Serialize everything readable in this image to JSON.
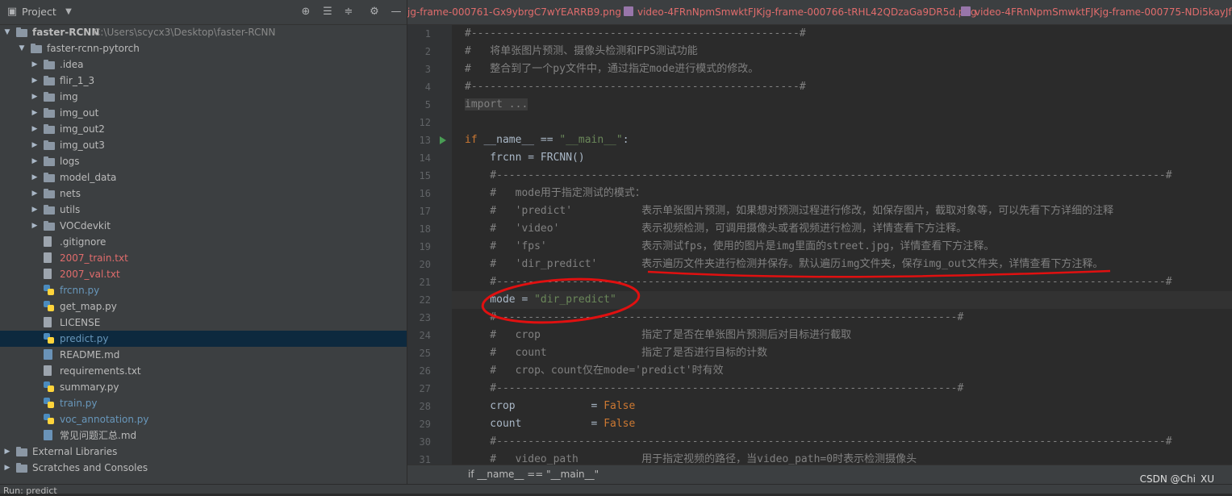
{
  "project": {
    "title": "Project",
    "tree": [
      {
        "label": "faster-RCNN",
        "extra": "C:\\Users\\scycx3\\Desktop\\faster-RCNN",
        "type": "folder",
        "depth": 0,
        "expanded": true
      },
      {
        "label": "faster-rcnn-pytorch",
        "type": "folder",
        "depth": 1,
        "expanded": true
      },
      {
        "label": ".idea",
        "type": "folder",
        "depth": 2,
        "expanded": false
      },
      {
        "label": "flir_1_3",
        "type": "folder",
        "depth": 2,
        "expanded": false
      },
      {
        "label": "img",
        "type": "folder",
        "depth": 2,
        "expanded": false
      },
      {
        "label": "img_out",
        "type": "folder",
        "depth": 2,
        "expanded": false
      },
      {
        "label": "img_out2",
        "type": "folder",
        "depth": 2,
        "expanded": false
      },
      {
        "label": "img_out3",
        "type": "folder",
        "depth": 2,
        "expanded": false
      },
      {
        "label": "logs",
        "type": "folder",
        "depth": 2,
        "expanded": false
      },
      {
        "label": "model_data",
        "type": "folder",
        "depth": 2,
        "expanded": false
      },
      {
        "label": "nets",
        "type": "folder",
        "depth": 2,
        "expanded": false
      },
      {
        "label": "utils",
        "type": "folder",
        "depth": 2,
        "expanded": false
      },
      {
        "label": "VOCdevkit",
        "type": "folder",
        "depth": 2,
        "expanded": false
      },
      {
        "label": ".gitignore",
        "type": "file",
        "depth": 2,
        "color": "gray"
      },
      {
        "label": "2007_train.txt",
        "type": "file",
        "depth": 2,
        "color": "red"
      },
      {
        "label": "2007_val.txt",
        "type": "file",
        "depth": 2,
        "color": "red"
      },
      {
        "label": "frcnn.py",
        "type": "py",
        "depth": 2,
        "color": "blue"
      },
      {
        "label": "get_map.py",
        "type": "py",
        "depth": 2,
        "color": "gray"
      },
      {
        "label": "LICENSE",
        "type": "file",
        "depth": 2,
        "color": "gray"
      },
      {
        "label": "predict.py",
        "type": "py",
        "depth": 2,
        "color": "blue",
        "selected": true
      },
      {
        "label": "README.md",
        "type": "md",
        "depth": 2,
        "color": "gray"
      },
      {
        "label": "requirements.txt",
        "type": "file",
        "depth": 2,
        "color": "gray"
      },
      {
        "label": "summary.py",
        "type": "py",
        "depth": 2,
        "color": "gray"
      },
      {
        "label": "train.py",
        "type": "py",
        "depth": 2,
        "color": "blue"
      },
      {
        "label": "voc_annotation.py",
        "type": "py",
        "depth": 2,
        "color": "blue"
      },
      {
        "label": "常见问题汇总.md",
        "type": "md",
        "depth": 2,
        "color": "gray"
      },
      {
        "label": "External Libraries",
        "type": "lib",
        "depth": 0,
        "expanded": false
      },
      {
        "label": "Scratches and Consoles",
        "type": "lib",
        "depth": 0,
        "expanded": false
      }
    ]
  },
  "tabs": [
    {
      "label": "jg-frame-000761-Gx9ybrgC7wYEARRB9.png"
    },
    {
      "label": "video-4FRnNpmSmwktFJKjg-frame-000766-tRHL42QDzaGa9DR5d.png"
    },
    {
      "label": "video-4FRnNpmSmwktFJKjg-frame-000775-NDi5kayJf6Jied5"
    }
  ],
  "editor": {
    "lines": [
      {
        "n": "1",
        "segs": [
          [
            "cmt",
            "#----------------------------------------------------#"
          ]
        ]
      },
      {
        "n": "2",
        "segs": [
          [
            "cmt",
            "#   将单张图片预测、摄像头检测和FPS测试功能"
          ]
        ]
      },
      {
        "n": "3",
        "segs": [
          [
            "cmt",
            "#   整合到了一个py文件中，通过指定mode进行模式的修改。"
          ]
        ]
      },
      {
        "n": "4",
        "segs": [
          [
            "cmt",
            "#----------------------------------------------------#"
          ]
        ]
      },
      {
        "n": "5",
        "segs": [
          [
            "fold",
            "import ..."
          ]
        ]
      },
      {
        "n": "12",
        "segs": []
      },
      {
        "n": "13",
        "segs": [
          [
            "kw",
            "if "
          ],
          [
            "",
            "__name__ == "
          ],
          [
            "str",
            "\"__main__\""
          ],
          [
            "",
            ":"
          ]
        ],
        "run": true
      },
      {
        "n": "14",
        "segs": [
          [
            "",
            "    frcnn = FRCNN()"
          ]
        ]
      },
      {
        "n": "15",
        "segs": [
          [
            "cmt",
            "    #----------------------------------------------------------------------------------------------------------#"
          ]
        ]
      },
      {
        "n": "16",
        "segs": [
          [
            "cmt",
            "    #   mode用于指定测试的模式："
          ]
        ]
      },
      {
        "n": "17",
        "segs": [
          [
            "cmt",
            "    #   'predict'           表示单张图片预测，如果想对预测过程进行修改，如保存图片，截取对象等，可以先看下方详细的注释"
          ]
        ]
      },
      {
        "n": "18",
        "segs": [
          [
            "cmt",
            "    #   'video'             表示视频检测，可调用摄像头或者视频进行检测，详情查看下方注释。"
          ]
        ]
      },
      {
        "n": "19",
        "segs": [
          [
            "cmt",
            "    #   'fps'               表示测试fps，使用的图片是img里面的street.jpg，详情查看下方注释。"
          ]
        ]
      },
      {
        "n": "20",
        "segs": [
          [
            "cmt",
            "    #   'dir_predict'       表示遍历文件夹进行检测并保存。默认遍历img文件夹，保存img_out文件夹，详情查看下方注释。"
          ]
        ]
      },
      {
        "n": "21",
        "segs": [
          [
            "cmt",
            "    #----------------------------------------------------------------------------------------------------------#"
          ]
        ]
      },
      {
        "n": "22",
        "segs": [
          [
            "",
            "    mode = "
          ],
          [
            "str",
            "\"dir_predict\""
          ]
        ],
        "caret": true
      },
      {
        "n": "23",
        "segs": [
          [
            "cmt",
            "    #-------------------------------------------------------------------------#"
          ]
        ]
      },
      {
        "n": "24",
        "segs": [
          [
            "cmt",
            "    #   crop                指定了是否在单张图片预测后对目标进行截取"
          ]
        ]
      },
      {
        "n": "25",
        "segs": [
          [
            "cmt",
            "    #   count               指定了是否进行目标的计数"
          ]
        ]
      },
      {
        "n": "26",
        "segs": [
          [
            "cmt",
            "    #   crop、count仅在mode='predict'时有效"
          ]
        ]
      },
      {
        "n": "27",
        "segs": [
          [
            "cmt",
            "    #-------------------------------------------------------------------------#"
          ]
        ]
      },
      {
        "n": "28",
        "segs": [
          [
            "",
            "    crop            = "
          ],
          [
            "kw",
            "False"
          ]
        ]
      },
      {
        "n": "29",
        "segs": [
          [
            "",
            "    count           = "
          ],
          [
            "kw",
            "False"
          ]
        ]
      },
      {
        "n": "30",
        "segs": [
          [
            "cmt",
            "    #----------------------------------------------------------------------------------------------------------#"
          ]
        ]
      },
      {
        "n": "31",
        "segs": [
          [
            "cmt",
            "    #   video_path          用于指定视频的路径，当video_path=0时表示检测摄像头"
          ]
        ]
      }
    ]
  },
  "breadcrumb": "if __name__ == \"__main__\"",
  "watermark": "CSDN @Chi_XU_",
  "bottom_bar": "Run: predict"
}
